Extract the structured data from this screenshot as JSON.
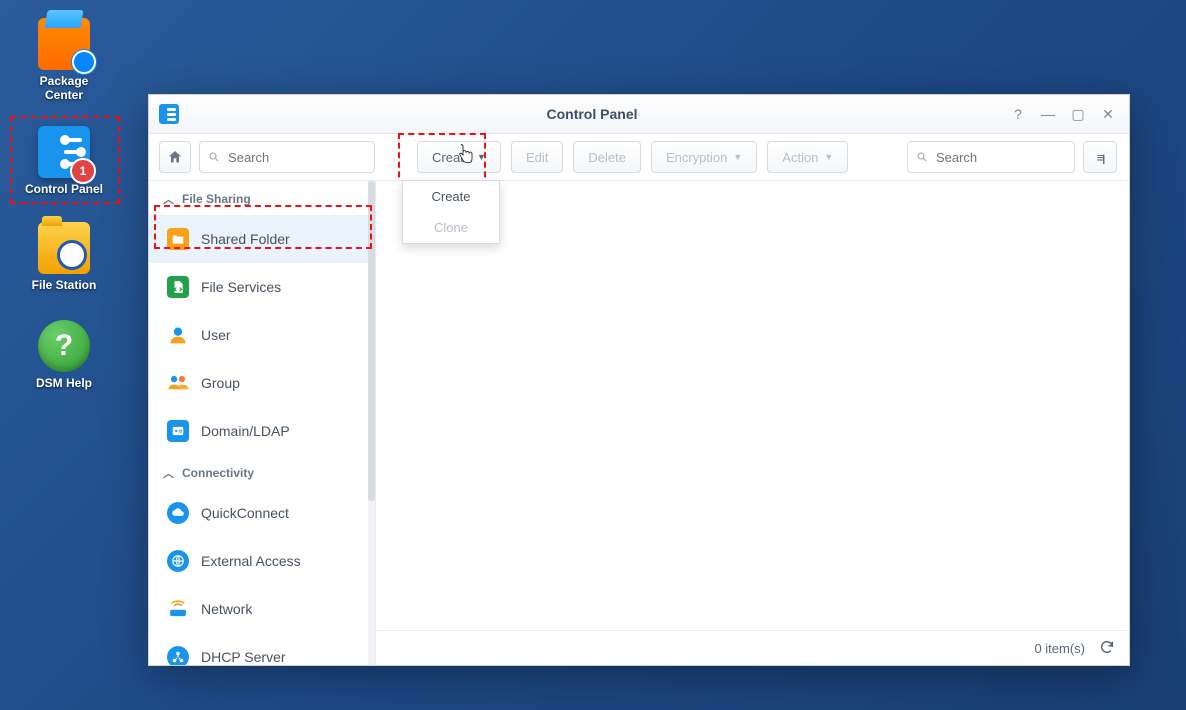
{
  "desktop": {
    "package_center": "Package\nCenter",
    "control_panel": "Control Panel",
    "control_panel_badge": "1",
    "file_station": "File Station",
    "dsm_help": "DSM Help",
    "help_glyph": "?"
  },
  "window": {
    "title": "Control Panel",
    "sidebar_search_placeholder": "Search",
    "main_search_placeholder": "Search",
    "toolbar": {
      "create": "Create",
      "edit": "Edit",
      "delete": "Delete",
      "encryption": "Encryption",
      "action": "Action"
    },
    "dropdown": {
      "create": "Create",
      "clone": "Clone"
    },
    "sidebar": {
      "sections": [
        {
          "title": "File Sharing",
          "items": [
            {
              "key": "shared",
              "label": "Shared Folder"
            },
            {
              "key": "fileserv",
              "label": "File Services"
            },
            {
              "key": "user",
              "label": "User"
            },
            {
              "key": "group",
              "label": "Group"
            },
            {
              "key": "domain",
              "label": "Domain/LDAP"
            }
          ]
        },
        {
          "title": "Connectivity",
          "items": [
            {
              "key": "qc",
              "label": "QuickConnect"
            },
            {
              "key": "ext",
              "label": "External Access"
            },
            {
              "key": "net",
              "label": "Network"
            },
            {
              "key": "dhcp",
              "label": "DHCP Server"
            }
          ]
        }
      ]
    },
    "status": {
      "count_text": "0 item(s)"
    },
    "controls": {
      "help": "?",
      "minimize": "—",
      "maximize": "▢",
      "close": "✕"
    },
    "sort_glyph": "≡↓"
  }
}
